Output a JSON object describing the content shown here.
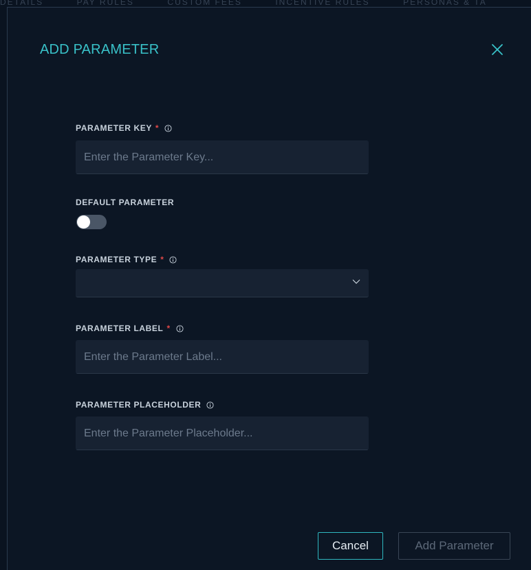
{
  "background_tabs": [
    "DETAILS",
    "PAY RULES",
    "CUSTOM FEES",
    "INCENTIVE RULES",
    "PERSONAS & TA"
  ],
  "modal": {
    "title": "ADD PARAMETER",
    "close_icon": "close-icon"
  },
  "fields": {
    "parameter_key": {
      "label": "PARAMETER KEY",
      "required_mark": "*",
      "placeholder": "Enter the Parameter Key...",
      "value": ""
    },
    "default_parameter": {
      "label": "DEFAULT PARAMETER",
      "on": false
    },
    "parameter_type": {
      "label": "PARAMETER TYPE",
      "required_mark": "*",
      "selected": ""
    },
    "parameter_label": {
      "label": "PARAMETER LABEL",
      "required_mark": "*",
      "placeholder": "Enter the Parameter Label...",
      "value": ""
    },
    "parameter_placeholder": {
      "label": "PARAMETER PLACEHOLDER",
      "placeholder": "Enter the Parameter Placeholder...",
      "value": ""
    }
  },
  "footer": {
    "cancel_label": "Cancel",
    "add_label": "Add Parameter"
  },
  "colors": {
    "background": "#0c1624",
    "accent": "#39c2c9",
    "required": "#e04848",
    "input_bg": "#172232"
  }
}
